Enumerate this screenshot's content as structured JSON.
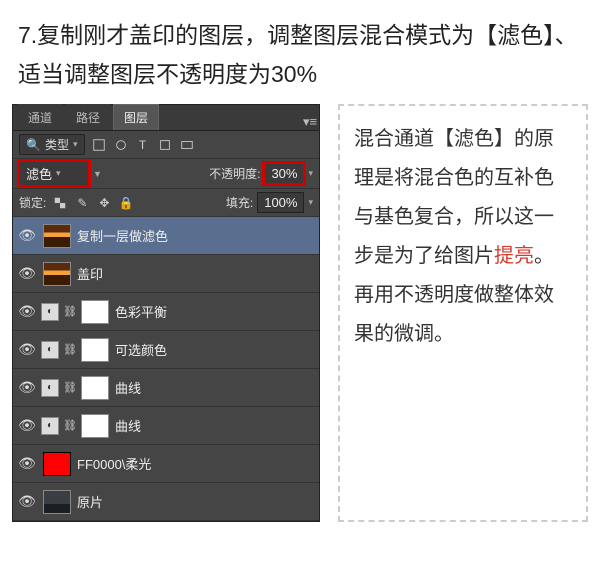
{
  "step": {
    "title": "7.复制刚才盖印的图层，调整图层混合模式为【滤色】、适当调整图层不透明度为30%"
  },
  "panel": {
    "tabs": [
      "通道",
      "路径",
      "图层"
    ],
    "active_tab": 2,
    "search_label": "类型",
    "blend_mode": "滤色",
    "opacity_label": "不透明度:",
    "opacity_value": "30%",
    "lock_label": "锁定:",
    "fill_label": "填充:",
    "fill_value": "100%"
  },
  "layers": [
    {
      "name": "复制一层做滤色",
      "kind": "image-sunset",
      "selected": true
    },
    {
      "name": "盖印",
      "kind": "image-sunset"
    },
    {
      "name": "色彩平衡",
      "kind": "adjust"
    },
    {
      "name": "可选颜色",
      "kind": "adjust"
    },
    {
      "name": "曲线",
      "kind": "adjust"
    },
    {
      "name": "曲线",
      "kind": "adjust"
    },
    {
      "name": "FF0000\\柔光",
      "kind": "solid-red"
    },
    {
      "name": "原片",
      "kind": "image-dark"
    }
  ],
  "explain": {
    "p1a": "混合通道【滤色】的原理是将混合色的互补色与基色复合，所以这一步是为了给图片",
    "p1hl": "提亮",
    "p1b": "。再用不透明度做整体效果的微调。"
  }
}
